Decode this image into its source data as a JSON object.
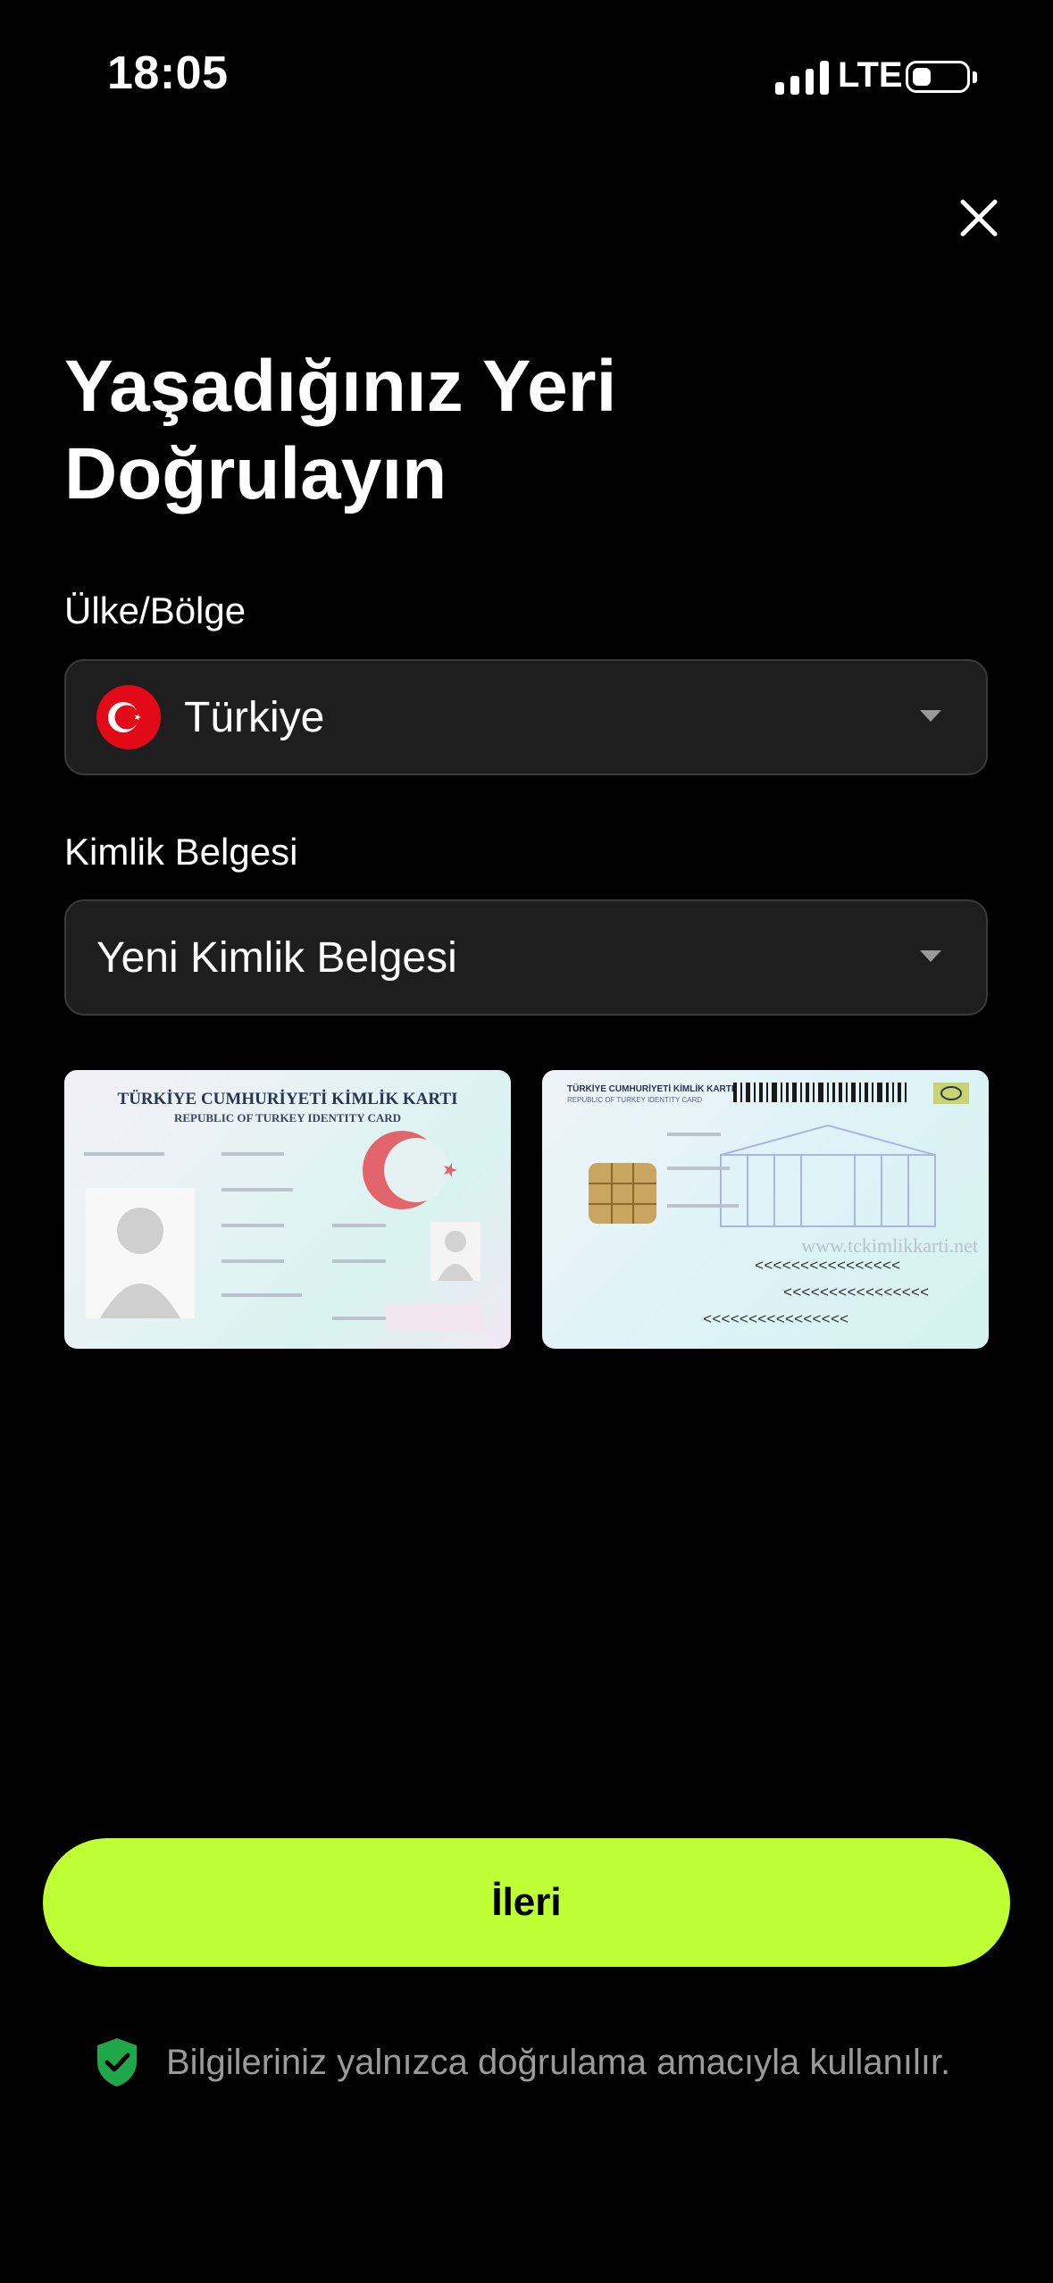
{
  "status_bar": {
    "time": "18:05",
    "network": "LTE",
    "icons": [
      "signal-icon",
      "battery-icon"
    ]
  },
  "header": {
    "close_icon": "close-icon",
    "title_line1": "Yaşadığınız Yeri",
    "title_line2": "Doğrulayın"
  },
  "country": {
    "label": "Ülke/Bölge",
    "value": "Türkiye",
    "flag_icon": "turkey-flag-icon"
  },
  "document": {
    "label": "Kimlik Belgesi",
    "value": "Yeni Kimlik Belgesi"
  },
  "card_front": {
    "title": "TÜRKİYE CUMHURİYETİ KİMLİK KARTI",
    "subtitle": "REPUBLIC OF TURKEY IDENTITY CARD"
  },
  "card_back": {
    "title": "TÜRKİYE CUMHURİYETİ KİMLİK KARTI",
    "subtitle": "REPUBLIC OF TURKEY IDENTITY CARD",
    "watermark": "www.tckimlikkarti.net",
    "mrz_line": "<<<<<<<<<<<<<<<<"
  },
  "footer": {
    "next_label": "İleri",
    "note": "Bilgileriniz yalnızca doğrulama amacıyla kullanılır.",
    "note_icon": "shield-check-icon"
  },
  "colors": {
    "accent": "#bdfe34",
    "background": "#000000",
    "field_bg": "#1e1e1e",
    "flag_red": "#e30a17",
    "shield_green": "#1fa84a"
  }
}
